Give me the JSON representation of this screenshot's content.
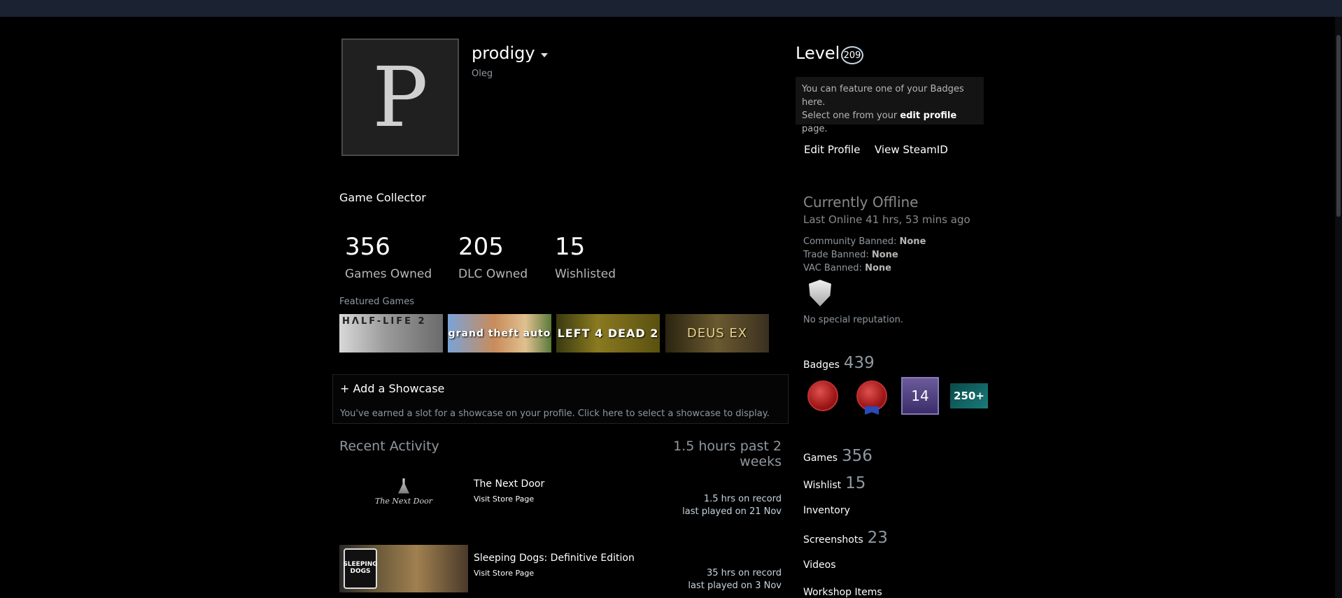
{
  "profile": {
    "avatar_letter": "P",
    "persona_name": "prodigy",
    "real_name": "Oleg",
    "favorite_group": "Game Collector"
  },
  "stats": [
    {
      "value": "356",
      "label": "Games Owned"
    },
    {
      "value": "205",
      "label": "DLC Owned"
    },
    {
      "value": "15",
      "label": "Wishlisted"
    }
  ],
  "featured": {
    "label": "Featured Games",
    "games": [
      {
        "tile_text": "HΛLF-LIFE 2"
      },
      {
        "tile_text": "grand theft auto"
      },
      {
        "tile_text": "LEFT 4 DEAD 2"
      },
      {
        "tile_text": "DEUS EX"
      }
    ]
  },
  "showcase": {
    "title": "+ Add a Showcase",
    "description": "You've earned a slot for a showcase on your profile. Click here to select a showcase to display."
  },
  "recent_activity": {
    "title": "Recent Activity",
    "hours_past": "1.5 hours past 2 weeks",
    "games": [
      {
        "name": "The Next Door",
        "store_link": "Visit Store Page",
        "hours": "1.5 hrs on record",
        "last_played": "last played on 21 Nov",
        "art_text": "The Next Door"
      },
      {
        "name": "Sleeping Dogs: Definitive Edition",
        "store_link": "Visit Store Page",
        "hours": "35 hrs on record",
        "last_played": "last played on 3 Nov",
        "art_text": "SLEEPING DOGS"
      }
    ]
  },
  "level": {
    "label": "Level",
    "value": "209"
  },
  "badge_feature": {
    "line1": "You can feature one of your Badges here.",
    "line2_pre": "Select one from your ",
    "line2_link": "edit profile",
    "line2_post": " page."
  },
  "actions": {
    "edit_profile": "Edit Profile",
    "view_steamid": "View SteamID"
  },
  "status": {
    "title": "Currently Offline",
    "last_online": "Last Online 41 hrs, 53 mins ago",
    "bans": [
      {
        "label": "Community Banned: ",
        "value": "None"
      },
      {
        "label": "Trade Banned: ",
        "value": "None"
      },
      {
        "label": "VAC Banned: ",
        "value": "None"
      }
    ],
    "reputation": "No special reputation."
  },
  "counts": {
    "badges": {
      "label": "Badges",
      "value": "439"
    },
    "games": {
      "label": "Games",
      "value": "356"
    },
    "wishlist": {
      "label": "Wishlist",
      "value": "15"
    },
    "inventory": {
      "label": "Inventory"
    },
    "screenshots": {
      "label": "Screenshots",
      "value": "23"
    },
    "videos": {
      "label": "Videos"
    },
    "workshop": {
      "label": "Workshop Items"
    }
  },
  "badge_icons": {
    "level_badge": "14",
    "collector_badge": "250+"
  },
  "colors": {
    "background": "#000000",
    "topbar": "#1b2231",
    "text_muted": "#8f98a0",
    "text_primary": "#ffffff"
  }
}
